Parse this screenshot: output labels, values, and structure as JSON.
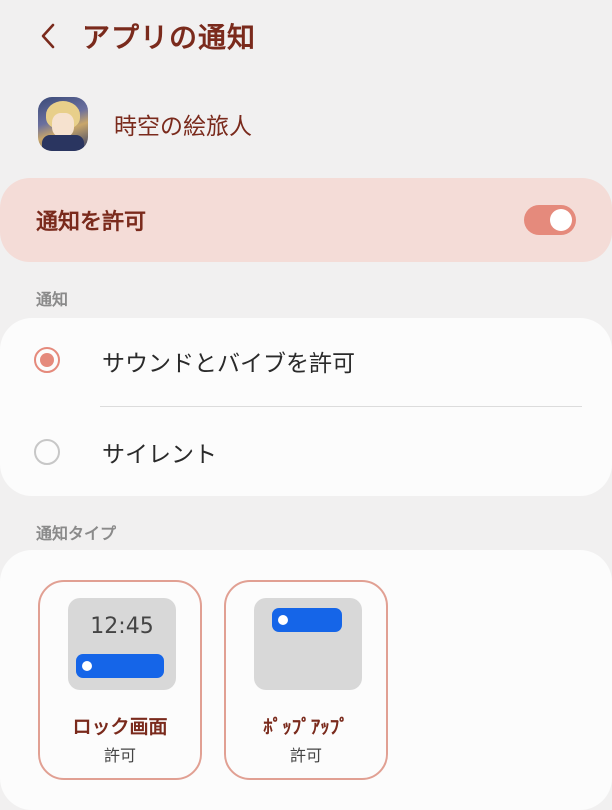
{
  "header": {
    "title": "アプリの通知"
  },
  "app": {
    "name": "時空の絵旅人"
  },
  "allow": {
    "label": "通知を許可",
    "enabled": true
  },
  "notifications": {
    "section_label": "通知",
    "options": [
      {
        "label": "サウンドとバイブを許可",
        "selected": true
      },
      {
        "label": "サイレント",
        "selected": false
      }
    ]
  },
  "notification_types": {
    "section_label": "通知タイプ",
    "items": [
      {
        "title": "ロック画面",
        "status": "許可",
        "preview_time": "12:45"
      },
      {
        "title": "ﾎﾟｯﾌﾟｱｯﾌﾟ",
        "status": "許可"
      }
    ]
  },
  "colors": {
    "accent": "#e58a7c",
    "title_text": "#7a2a1c",
    "notif_blue": "#1565e8"
  }
}
